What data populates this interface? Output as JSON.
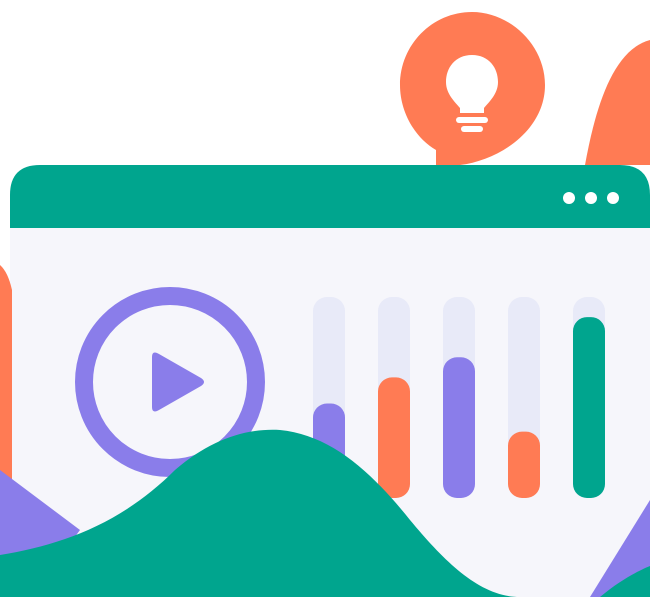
{
  "colors": {
    "teal": "#00A58E",
    "orange": "#FF7B54",
    "purple": "#8A7DEA",
    "panel": "#F6F6FB",
    "track": "#E8EAF8",
    "white": "#FFFFFF"
  },
  "icons": {
    "lightbulb": "lightbulb-icon",
    "play": "play-icon",
    "window_menu": "three-dots-icon"
  },
  "chart_data": {
    "type": "bar",
    "categories": [
      "",
      "",
      "",
      "",
      ""
    ],
    "values": [
      0.47,
      0.6,
      0.7,
      0.33,
      0.9
    ],
    "series_colors": [
      "purple",
      "orange",
      "purple",
      "orange",
      "teal"
    ],
    "ylim": [
      0,
      1
    ],
    "title": "",
    "xlabel": "",
    "ylabel": ""
  }
}
